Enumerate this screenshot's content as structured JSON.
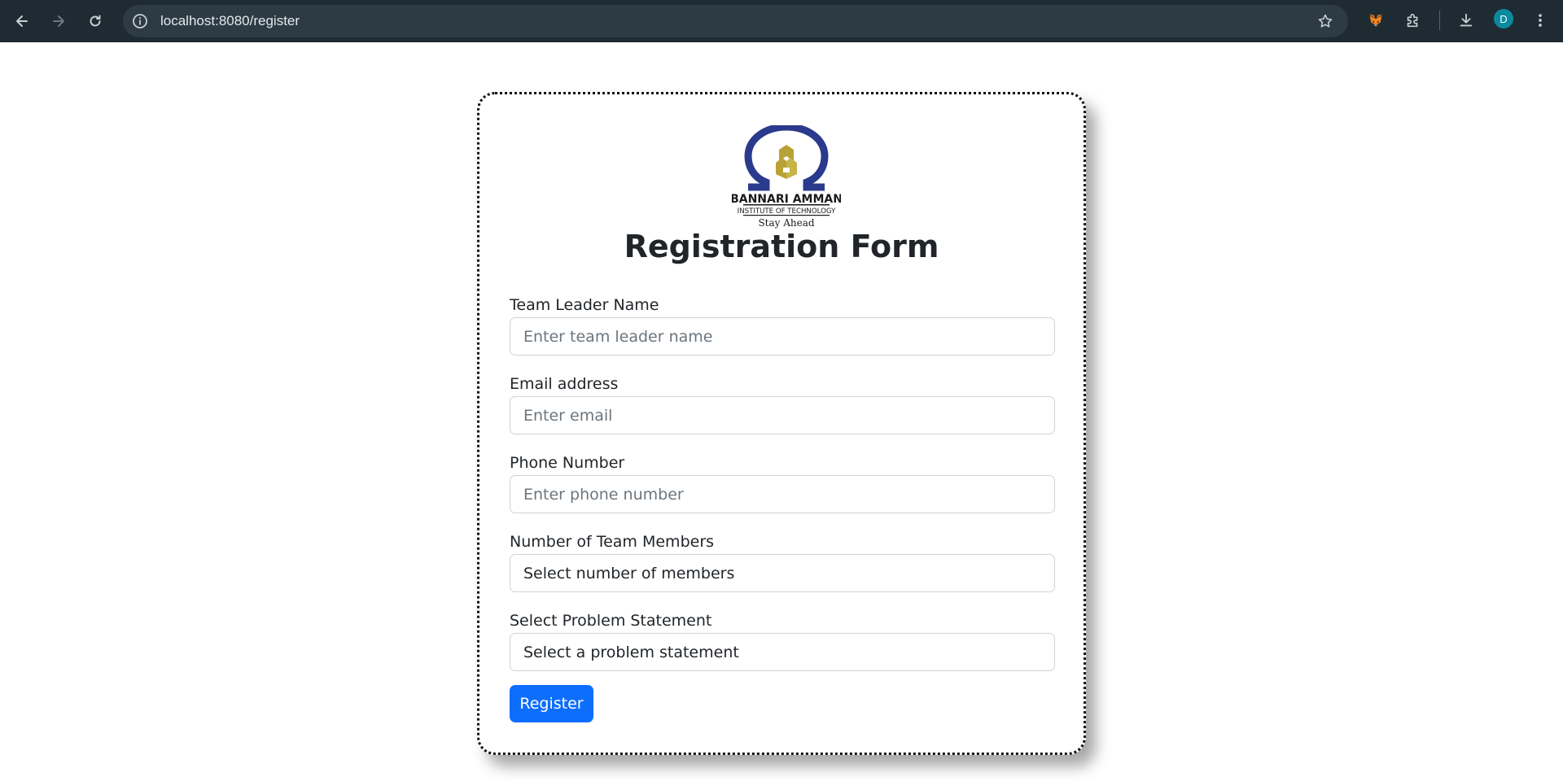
{
  "browser": {
    "url": "localhost:8080/register",
    "avatar_letter": "D"
  },
  "logo": {
    "line1": "BANNARI AMMAN",
    "line2": "INSTITUTE OF TECHNOLOGY",
    "tagline": "Stay Ahead"
  },
  "form": {
    "title": "Registration Form",
    "fields": [
      {
        "label": "Team Leader Name",
        "placeholder": "Enter team leader name"
      },
      {
        "label": "Email address",
        "placeholder": "Enter email"
      },
      {
        "label": "Phone Number",
        "placeholder": "Enter phone number"
      }
    ],
    "selects": [
      {
        "label": "Number of Team Members",
        "value": "Select number of members"
      },
      {
        "label": "Select Problem Statement",
        "value": "Select a problem statement"
      }
    ],
    "submit_label": "Register"
  },
  "colors": {
    "chrome_bg": "#1e2b33",
    "primary_button": "#0d6efd",
    "logo_blue": "#2a3a8c",
    "logo_gold": "#b8a236"
  }
}
